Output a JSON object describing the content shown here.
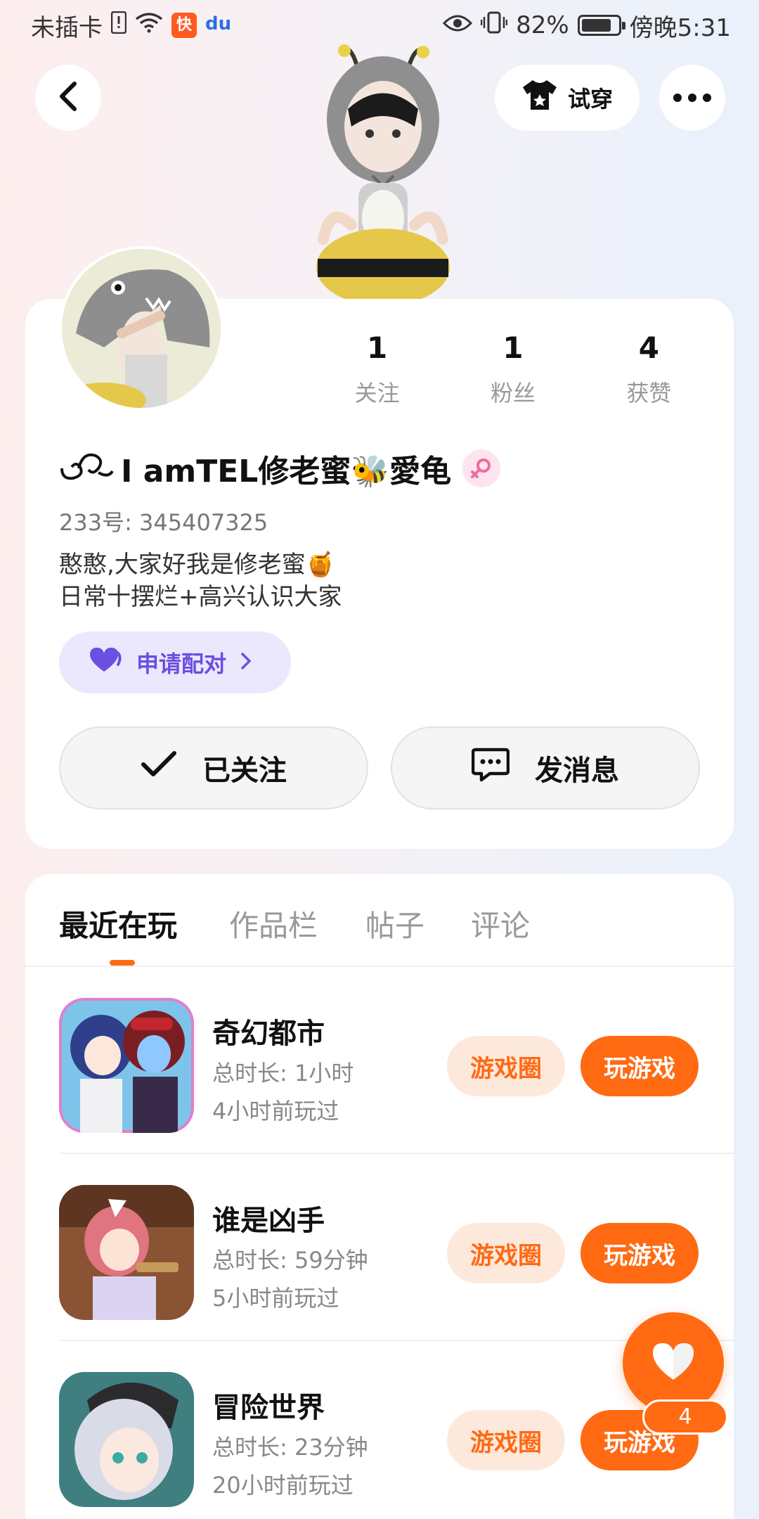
{
  "status_bar": {
    "carrier": "未插卡",
    "kuaishou_icon": "快",
    "baidu_icon": "du",
    "battery_pct": "82%",
    "battery_level": 0.82,
    "time": "傍晚5:31"
  },
  "header": {
    "tryon_label": "试穿"
  },
  "profile": {
    "stats": [
      {
        "value": "1",
        "label": "关注"
      },
      {
        "value": "1",
        "label": "粉丝"
      },
      {
        "value": "4",
        "label": "获赞"
      }
    ],
    "username": "I amTEL修老蜜🐝愛龟",
    "uid": "233号: 345407325",
    "bio_line1": "憨憨,大家好我是修老蜜🍯",
    "bio_line2": "日常十摆烂+高兴认识大家",
    "pair_label": "申请配对",
    "follow_label": "已关注",
    "message_label": "发消息"
  },
  "tabs": [
    {
      "label": "最近在玩",
      "active": true
    },
    {
      "label": "作品栏",
      "active": false
    },
    {
      "label": "帖子",
      "active": false
    },
    {
      "label": "评论",
      "active": false
    }
  ],
  "games": [
    {
      "name": "奇幻都市",
      "duration": "总时长: 1小时",
      "last_played": "4小时前玩过",
      "circle_label": "游戏圈",
      "play_label": "玩游戏"
    },
    {
      "name": "谁是凶手",
      "duration": "总时长: 59分钟",
      "last_played": "5小时前玩过",
      "circle_label": "游戏圈",
      "play_label": "玩游戏"
    },
    {
      "name": "冒险世界",
      "duration": "总时长: 23分钟",
      "last_played": "20小时前玩过",
      "circle_label": "游戏圈",
      "play_label": "玩游戏"
    }
  ],
  "like_fab": {
    "count": "4"
  },
  "colors": {
    "accent": "#ff6a13",
    "pair_purple": "#6b4fe0"
  }
}
